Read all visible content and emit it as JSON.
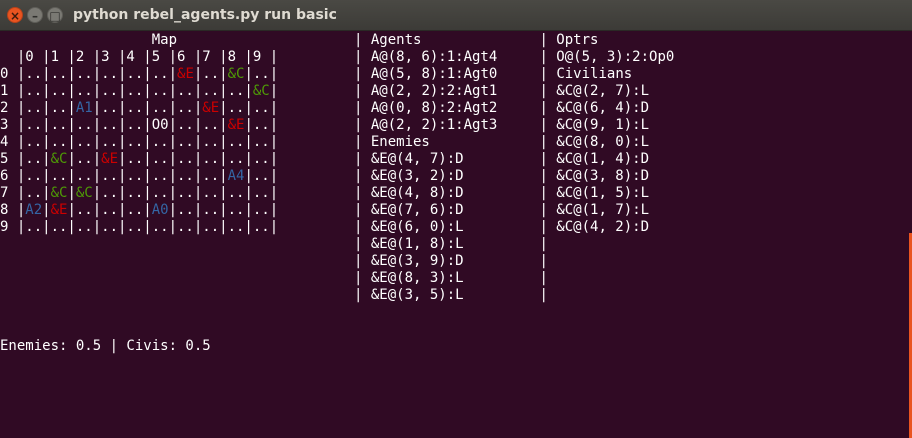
{
  "window": {
    "title": "python rebel_agents.py run basic",
    "close_glyph": "×",
    "minimize_glyph": "–",
    "maximize_glyph": "□"
  },
  "terminal": {
    "lines": [
      {
        "segs": [
          {
            "t": "                  Map                     | Agents              | Optrs"
          }
        ]
      },
      {
        "segs": [
          {
            "t": "  |0 |1 |2 |3 |4 |5 |6 |7 |8 |9 |         | A@(8, 6):1:Agt4     | O@(5, 3):2:Op0"
          }
        ]
      },
      {
        "segs": [
          {
            "t": "0 |..|..|..|..|..|..|"
          },
          {
            "t": "&E",
            "c": "red"
          },
          {
            "t": "|..|"
          },
          {
            "t": "&C",
            "c": "green"
          },
          {
            "t": "|..|         | A@(5, 8):1:Agt0     | Civilians"
          }
        ]
      },
      {
        "segs": [
          {
            "t": "1 |..|..|..|..|..|..|..|..|..|"
          },
          {
            "t": "&C",
            "c": "green"
          },
          {
            "t": "|         | A@(2, 2):2:Agt1     | &C@(2, 7):L"
          }
        ]
      },
      {
        "segs": [
          {
            "t": "2 |..|..|"
          },
          {
            "t": "A1",
            "c": "blue"
          },
          {
            "t": "|..|..|..|..|"
          },
          {
            "t": "&E",
            "c": "red"
          },
          {
            "t": "|..|..|         | A@(0, 8):2:Agt2     | &C@(6, 4):D"
          }
        ]
      },
      {
        "segs": [
          {
            "t": "3 |..|..|..|..|..|O0|..|..|"
          },
          {
            "t": "&E",
            "c": "red"
          },
          {
            "t": "|..|         | A@(2, 2):1:Agt3     | &C@(9, 1):L"
          }
        ]
      },
      {
        "segs": [
          {
            "t": "4 |..|..|..|..|..|..|..|..|..|..|         | Enemies             | &C@(8, 0):L"
          }
        ]
      },
      {
        "segs": [
          {
            "t": "5 |..|"
          },
          {
            "t": "&C",
            "c": "green"
          },
          {
            "t": "|..|"
          },
          {
            "t": "&E",
            "c": "red"
          },
          {
            "t": "|..|..|..|..|..|..|         | &E@(4, 7):D         | &C@(1, 4):D"
          }
        ]
      },
      {
        "segs": [
          {
            "t": "6 |..|..|..|..|..|..|..|..|"
          },
          {
            "t": "A4",
            "c": "blue"
          },
          {
            "t": "|..|         | &E@(3, 2):D         | &C@(3, 8):D"
          }
        ]
      },
      {
        "segs": [
          {
            "t": "7 |..|"
          },
          {
            "t": "&C",
            "c": "green"
          },
          {
            "t": "|"
          },
          {
            "t": "&C",
            "c": "green"
          },
          {
            "t": "|..|..|..|..|..|..|..|         | &E@(4, 8):D         | &C@(1, 5):L"
          }
        ]
      },
      {
        "segs": [
          {
            "t": "8 |"
          },
          {
            "t": "A2",
            "c": "blue"
          },
          {
            "t": "|"
          },
          {
            "t": "&E",
            "c": "red"
          },
          {
            "t": "|..|..|..|"
          },
          {
            "t": "A0",
            "c": "blue"
          },
          {
            "t": "|..|..|..|..|         | &E@(7, 6):D         | &C@(1, 7):L"
          }
        ]
      },
      {
        "segs": [
          {
            "t": "9 |..|..|..|..|..|..|..|..|..|..|         | &E@(6, 0):L         | &C@(4, 2):D"
          }
        ]
      },
      {
        "segs": [
          {
            "t": "                                          | &E@(1, 8):L         |"
          }
        ]
      },
      {
        "segs": [
          {
            "t": "                                          | &E@(3, 9):D         |"
          }
        ]
      },
      {
        "segs": [
          {
            "t": "                                          | &E@(8, 3):L         |"
          }
        ]
      },
      {
        "segs": [
          {
            "t": "                                          | &E@(3, 5):L         |"
          }
        ]
      },
      {
        "segs": [
          {
            "t": ""
          }
        ]
      },
      {
        "segs": [
          {
            "t": ""
          }
        ]
      },
      {
        "segs": [
          {
            "t": "Enemies: 0.5 | Civis: 0.5"
          }
        ]
      }
    ]
  }
}
